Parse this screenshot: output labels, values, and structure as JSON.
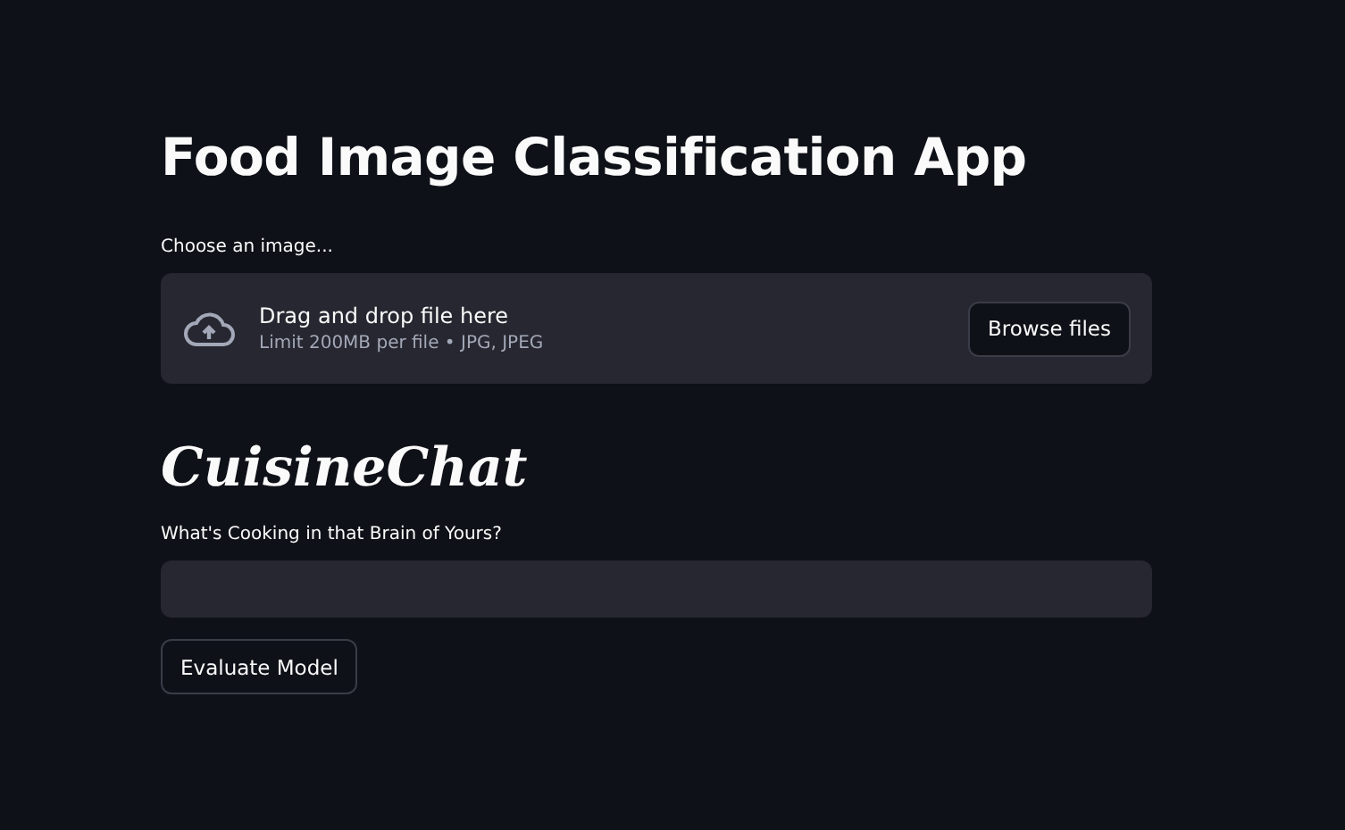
{
  "title": "Food Image Classification App",
  "uploader": {
    "label": "Choose an image...",
    "dropzone_text": "Drag and drop file here",
    "limit_text": "Limit 200MB per file • JPG, JPEG",
    "button": "Browse files"
  },
  "chat_title": "CuisineChat",
  "question": {
    "label": "What's Cooking in that Brain of Yours?"
  },
  "buttons": [
    "Evaluate Model"
  ]
}
